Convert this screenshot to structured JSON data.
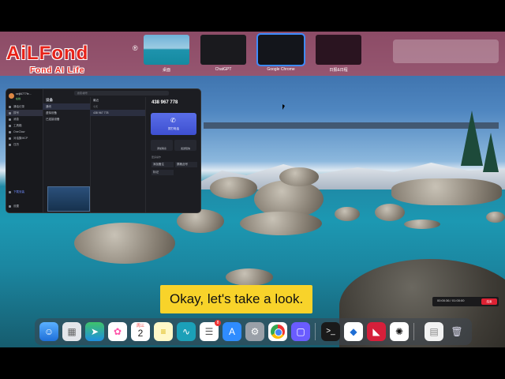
{
  "logo": {
    "main": "AiLFond",
    "reg": "®",
    "sub": "Fond AI Life"
  },
  "spaces": [
    {
      "label": "桌面"
    },
    {
      "label": "ChatGPT"
    },
    {
      "label": "Google Chrome"
    },
    {
      "label": "日报&日程"
    }
  ],
  "app": {
    "user_name": "seiji6777fe...",
    "user_status": "在线",
    "search_placeholder": "搜索/拨号",
    "sidebar": [
      {
        "label": "通话记录"
      },
      {
        "label": "拨号"
      },
      {
        "label": "消息"
      },
      {
        "label": "工具箱"
      },
      {
        "label": "OneClaw"
      },
      {
        "label": "对话集MCP"
      },
      {
        "label": "日历"
      }
    ],
    "sidebar_bottom": [
      {
        "label": "下载安装"
      },
      {
        "label": "设置"
      }
    ],
    "col2_title": "设备",
    "col2_items": [
      {
        "label": "通讯"
      },
      {
        "label": "虚拟设备"
      },
      {
        "label": "已连接设备"
      }
    ],
    "col3_title": "最近",
    "col3_section": "今天",
    "phone_small": "438 967 778",
    "phone_main": "438 967 778",
    "call_label": "拨打电话",
    "small_buttons": [
      {
        "label": "添加联系"
      },
      {
        "label": "发送短信"
      }
    ],
    "more_title": "更多操作",
    "more_buttons": [
      {
        "label": "添加备注"
      },
      {
        "label": "屏蔽此号"
      },
      {
        "label": "标记"
      }
    ]
  },
  "caption": "Okay, let's take a look.",
  "recorder": {
    "time": "00:00:36 / 01:00:00",
    "stop": "结束"
  },
  "dock": {
    "calendar_date": "2",
    "calendar_month": "周三",
    "reminders_badge": "8"
  },
  "colors": {
    "caption_bg": "#f8d32a",
    "accent": "#4a5ee0",
    "logo": "#e8231a"
  }
}
